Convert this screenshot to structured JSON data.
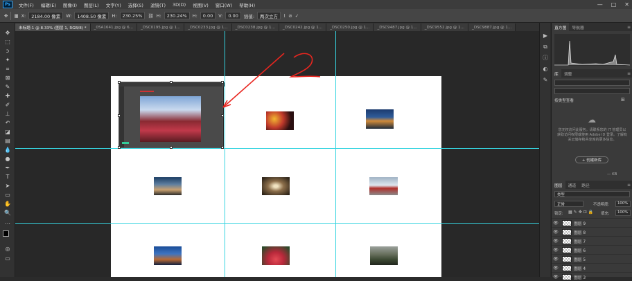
{
  "app": {
    "logo": "Ps"
  },
  "menu": [
    "文件(F)",
    "编辑(E)",
    "图像(I)",
    "图层(L)",
    "文字(Y)",
    "选择(S)",
    "滤镜(T)",
    "3D(D)",
    "视图(V)",
    "窗口(W)",
    "帮助(H)"
  ],
  "window_controls": {
    "minimize": "—",
    "maximize": "□",
    "close": "✕"
  },
  "options": {
    "x_label": "X:",
    "x_value": "2184.00 像素",
    "w_label": "W:",
    "w_value": "1408.50 像素",
    "h_label": "H:",
    "h_value": "230.25%",
    "angle_label": "H:",
    "angle_value": "230.24%",
    "rot_label": "H:",
    "rot_value": "0.00",
    "v_label": "V:",
    "v_value": "0.00",
    "interp_label": "插值:",
    "interp_value": "两次立方",
    "cancel": "⊘",
    "commit": "✓"
  },
  "tabs": [
    {
      "label": "未标题-1 @ 8.33% (图层 1, RGB/8) *",
      "active": true
    },
    {
      "label": "_05A1641.jpg @ 6...",
      "active": false
    },
    {
      "label": "_DSC0195.jpg @ 1...",
      "active": false
    },
    {
      "label": "_DSC0233.jpg @ 1...",
      "active": false
    },
    {
      "label": "_DSC0238.jpg @ 1...",
      "active": false
    },
    {
      "label": "_DSC0242.jpg @ 1...",
      "active": false
    },
    {
      "label": "_DSC0250.jpg @ 1...",
      "active": false
    },
    {
      "label": "_DSC9487.jpg @ 1...",
      "active": false
    },
    {
      "label": "_DSC9552.jpg @ 1...",
      "active": false
    },
    {
      "label": "_DSC9887.jpg @ 1...",
      "active": false
    }
  ],
  "tabs_more": "»",
  "panels": {
    "histogram_tabs": [
      "直方图",
      "导航器"
    ],
    "library_tabs": [
      "库",
      "调整"
    ],
    "library_search_placeholder": "",
    "library_filter": "按类型查看",
    "library_message": "您无权访问此服务。请联系您的 IT 管理员以获取访问权限或使用 Adobe ID 登录。了解有关云储存和共享库的更多信息。",
    "library_button": "+ 创建新库",
    "library_kb": "— KB",
    "layers_tabs": [
      "图层",
      "通道",
      "路径"
    ],
    "layers_kind": "类型",
    "blend_mode": "正常",
    "opacity_label": "不透明度:",
    "opacity_value": "100%",
    "lock_label": "锁定:",
    "fill_label": "填充:",
    "fill_value": "100%",
    "layers": [
      "图层 9",
      "图层 8",
      "图层 7",
      "图层 6",
      "图层 5",
      "图层 4",
      "图层 3"
    ]
  },
  "colors": {
    "guide": "#36d4e0",
    "accent": "#31a8ff",
    "annotation": "#e8261f"
  }
}
